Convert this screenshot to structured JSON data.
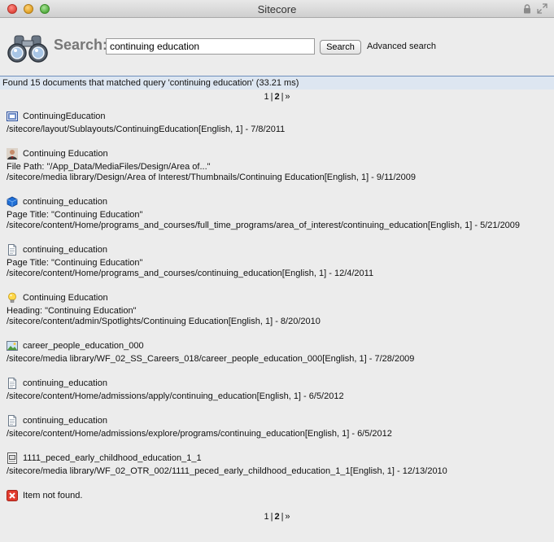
{
  "window": {
    "title": "Sitecore"
  },
  "search": {
    "label": "Search:",
    "value": "continuing education",
    "button": "Search",
    "advanced": "Advanced search"
  },
  "status": "Found 15 documents that matched query 'continuing education' (33.21 ms)",
  "pager": {
    "page1": "1",
    "sep1": "|",
    "page2": "2",
    "sep2": "|",
    "next": "»"
  },
  "results": [
    {
      "title": "ContinuingEducation",
      "icon": "sublayout-icon",
      "lines": [
        "/sitecore/layout/Sublayouts/ContinuingEducation[English, 1] - 7/8/2011"
      ]
    },
    {
      "title": "Continuing Education",
      "icon": "person-image-icon",
      "lines": [
        "File Path: \"/App_Data/MediaFiles/Design/Area of...\"",
        "/sitecore/media library/Design/Area of Interest/Thumbnails/Continuing Education[English, 1] - 9/11/2009"
      ]
    },
    {
      "title": "continuing_education",
      "icon": "blue-cube-icon",
      "lines": [
        "Page Title: \"Continuing Education\"",
        "/sitecore/content/Home/programs_and_courses/full_time_programs/area_of_interest/continuing_education[English, 1] - 5/21/2009"
      ]
    },
    {
      "title": "continuing_education",
      "icon": "document-icon",
      "lines": [
        "Page Title: \"Continuing Education\"",
        "/sitecore/content/Home/programs_and_courses/continuing_education[English, 1] - 12/4/2011"
      ]
    },
    {
      "title": "Continuing Education",
      "icon": "lightbulb-icon",
      "lines": [
        "Heading: \"Continuing Education\"",
        "/sitecore/content/admin/Spotlights/Continuing Education[English, 1] - 8/20/2010"
      ]
    },
    {
      "title": "career_people_education_000",
      "icon": "picture-icon",
      "lines": [
        "/sitecore/media library/WF_02_SS_Careers_018/career_people_education_000[English, 1] - 7/28/2009"
      ]
    },
    {
      "title": "continuing_education",
      "icon": "document-icon",
      "lines": [
        "/sitecore/content/Home/admissions/apply/continuing_education[English, 1] - 6/5/2012"
      ]
    },
    {
      "title": "continuing_education",
      "icon": "document-icon",
      "lines": [
        "/sitecore/content/Home/admissions/explore/programs/continuing_education[English, 1] - 6/5/2012"
      ]
    },
    {
      "title": "1111_peced_early_childhood_education_1_1",
      "icon": "file-image-icon",
      "lines": [
        "/sitecore/media library/WF_02_OTR_002/1111_peced_early_childhood_education_1_1[English, 1] - 12/13/2010"
      ]
    },
    {
      "title": "Item not found.",
      "icon": "error-icon",
      "lines": []
    }
  ]
}
